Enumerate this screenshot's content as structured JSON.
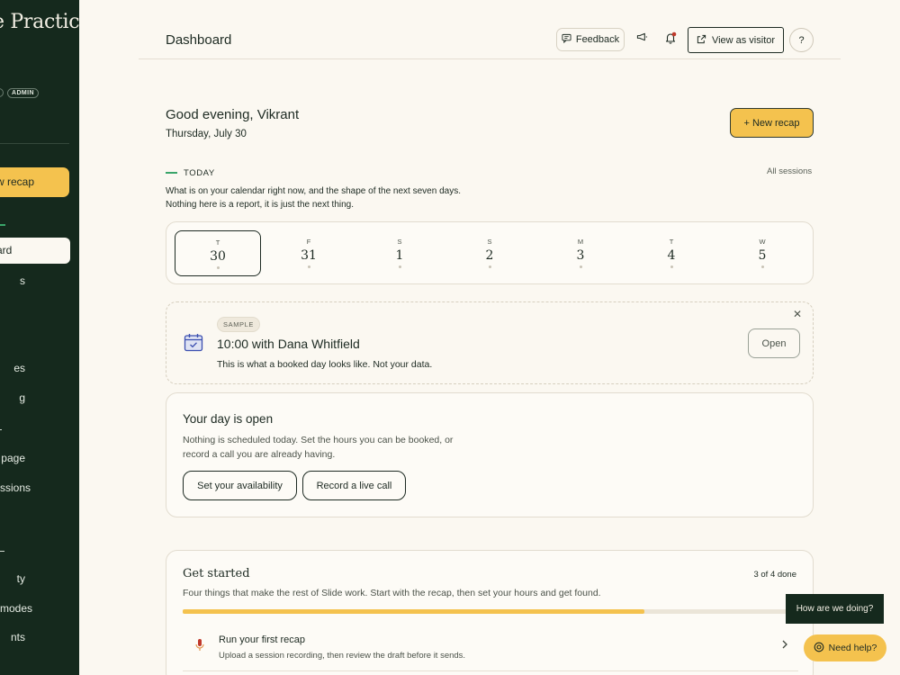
{
  "sidebar": {
    "brand": "e Practice",
    "admin_badge": "ADMIN",
    "new_recap_label": "w recap",
    "active_item": "ard",
    "items": [
      {
        "label": "s"
      },
      {
        "label": "es"
      },
      {
        "label": "g"
      },
      {
        "label": "page"
      },
      {
        "label": "ssions"
      },
      {
        "label": "ty"
      },
      {
        "label": "modes"
      },
      {
        "label": "nts"
      }
    ]
  },
  "header": {
    "title": "Dashboard",
    "feedback_label": "Feedback",
    "view_as_visitor_label": "View as visitor",
    "help_label": "?"
  },
  "greeting": {
    "text": "Good evening, Vikrant",
    "date": "Thursday, July 30",
    "new_recap_label": "+ New recap"
  },
  "today": {
    "label": "TODAY",
    "all_sessions_label": "All sessions",
    "line1": "What is on your calendar right now, and the shape of the next seven days.",
    "line2": "Nothing here is a report, it is just the next thing."
  },
  "week": [
    {
      "weekday": "T",
      "date": "30",
      "selected": true
    },
    {
      "weekday": "F",
      "date": "31",
      "selected": false
    },
    {
      "weekday": "S",
      "date": "1",
      "selected": false
    },
    {
      "weekday": "S",
      "date": "2",
      "selected": false
    },
    {
      "weekday": "M",
      "date": "3",
      "selected": false
    },
    {
      "weekday": "T",
      "date": "4",
      "selected": false
    },
    {
      "weekday": "W",
      "date": "5",
      "selected": false
    }
  ],
  "sample_card": {
    "badge": "SAMPLE",
    "title": "10:00 with Dana Whitfield",
    "description": "This is what a booked day looks like. Not your data.",
    "open_label": "Open",
    "close_glyph": "✕"
  },
  "day_open": {
    "title": "Your day is open",
    "line1": "Nothing is scheduled today. Set the hours you can be booked, or",
    "line2": "record a call you are already having.",
    "availability_label": "Set your availability",
    "record_label": "Record a live call"
  },
  "get_started": {
    "title": "Get started",
    "count": "3 of 4 done",
    "description": "Four things that make the rest of Slide work. Start with the recap, then set your hours and get found.",
    "progress_fraction": 0.75,
    "item_title": "Run your first recap",
    "item_desc": "Upload a session recording, then review the draft before it sends."
  },
  "floating": {
    "survey_label": "How are we doing?",
    "need_help_label": "Need help?"
  },
  "colors": {
    "sidebar_bg": "#15291d",
    "accent_yellow": "#f4c24e",
    "accent_green": "#3aa56a",
    "page_bg": "#fbf8f1",
    "notification_dot": "#c0392b"
  }
}
